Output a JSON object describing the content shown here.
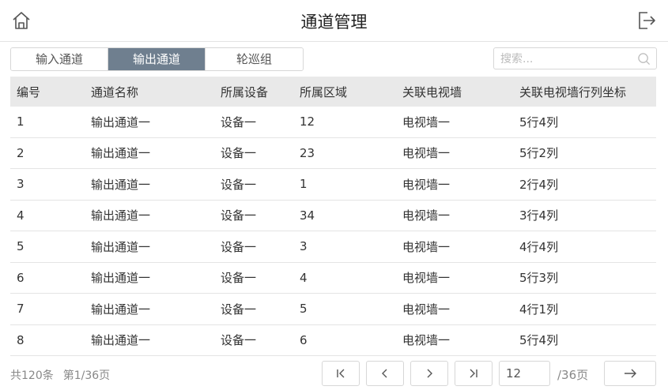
{
  "header": {
    "title": "通道管理",
    "home_icon": "home-icon",
    "exit_icon": "logout-icon"
  },
  "tabs": [
    {
      "label": "输入通道",
      "active": false
    },
    {
      "label": "输出通道",
      "active": true
    },
    {
      "label": "轮巡组",
      "active": false
    }
  ],
  "search": {
    "placeholder": "搜索...",
    "icon": "search-icon"
  },
  "table": {
    "columns": [
      "编号",
      "通道名称",
      "所属设备",
      "所属区域",
      "关联电视墙",
      "关联电视墙行列坐标"
    ],
    "rows": [
      [
        "1",
        "输出通道一",
        "设备一",
        "12",
        "电视墙一",
        "5行4列"
      ],
      [
        "2",
        "输出通道一",
        "设备一",
        "23",
        "电视墙一",
        "5行2列"
      ],
      [
        "3",
        "输出通道一",
        "设备一",
        "1",
        "电视墙一",
        "2行4列"
      ],
      [
        "4",
        "输出通道一",
        "设备一",
        "34",
        "电视墙一",
        "3行4列"
      ],
      [
        "5",
        "输出通道一",
        "设备一",
        "3",
        "电视墙一",
        "4行4列"
      ],
      [
        "6",
        "输出通道一",
        "设备一",
        "4",
        "电视墙一",
        "5行3列"
      ],
      [
        "7",
        "输出通道一",
        "设备一",
        "5",
        "电视墙一",
        "4行1列"
      ],
      [
        "8",
        "输出通道一",
        "设备一",
        "6",
        "电视墙一",
        "5行4列"
      ]
    ]
  },
  "footer": {
    "total": "共120条",
    "page_info": "第1/36页",
    "page_input": "12",
    "total_pages": "/36页",
    "buttons": {
      "first": "first-page-icon",
      "prev": "prev-page-icon",
      "next": "next-page-icon",
      "last": "last-page-icon",
      "go": "go-arrow-icon"
    }
  },
  "colors": {
    "active_tab": "#6f7f8f",
    "header_row": "#e9e9e9",
    "border": "#d7d7d7"
  }
}
